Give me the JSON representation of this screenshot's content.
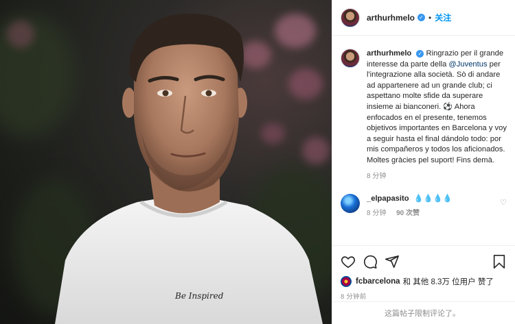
{
  "post": {
    "username": "arthurhmelo",
    "verified_mark": "✓",
    "separator": "•",
    "follow_label": "关注",
    "caption": {
      "text_part1": "Ringrazio per il grande interesse da parte della ",
      "mention": "@Juventus",
      "text_part2": " per l'integrazione alla società. Sò di andare ad appartenere ad un grande club; ci aspettano molte sfide da superare insieme ai bianconeri. ⚽ Ahora enfocados en el presente, tenemos objetivos importantes en Barcelona y voy a seguir hasta el final dándolo todo: por mis compañeros y todos los aficionados. Moltes gràcies pel suport! Fins demà.",
      "time": "8 分钟"
    },
    "comment": {
      "username": "_elpapasito",
      "text": "💧💧💧💧",
      "time": "8 分钟",
      "likes": "90 次赞"
    },
    "liked_by": {
      "user": "fcbarcelona",
      "text": "和 其他 8.3万 位用户 赞了",
      "others_bold": "其他 8.3万 位用户"
    },
    "post_time": "8 分钟前",
    "comments_disabled": "这篇帖子限制评论了。",
    "shirt_text": "Be Inspired",
    "icons": [
      "heart-icon",
      "comment-icon",
      "share-icon",
      "bookmark-icon"
    ],
    "colors": {
      "link": "#0095f6",
      "verified": "#3897f0",
      "muted": "#8e8e8e"
    }
  }
}
